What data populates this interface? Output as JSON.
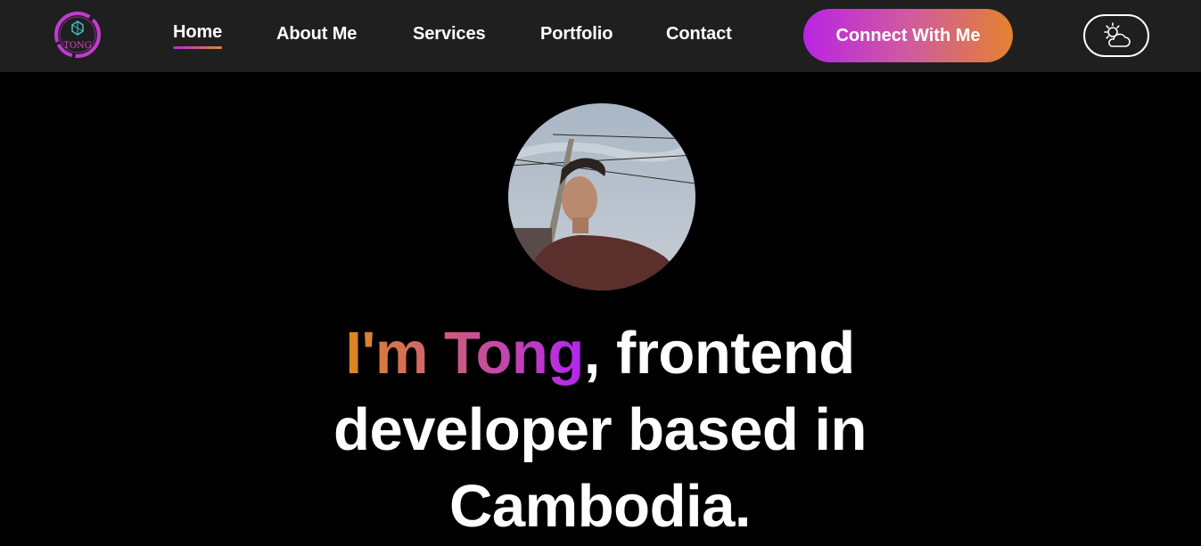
{
  "brand": {
    "logo_text": "TONG",
    "logo_icon": "geometric-logo-icon"
  },
  "nav": {
    "items": [
      {
        "label": "Home",
        "active": true
      },
      {
        "label": "About Me",
        "active": false
      },
      {
        "label": "Services",
        "active": false
      },
      {
        "label": "Portfolio",
        "active": false
      },
      {
        "label": "Contact",
        "active": false
      }
    ],
    "cta_label": "Connect With Me",
    "theme_toggle_icon": "sun-cloud-icon"
  },
  "hero": {
    "avatar_icon": "profile-photo",
    "intro": "I'm Tong",
    "comma_rest": ", frontend",
    "line2": "developer based in",
    "line3": "Cambodia."
  },
  "colors": {
    "navbar_bg": "#1f1f1f",
    "page_bg": "#000000",
    "gradient_start": "#b924e2",
    "gradient_end": "#e4822f"
  }
}
